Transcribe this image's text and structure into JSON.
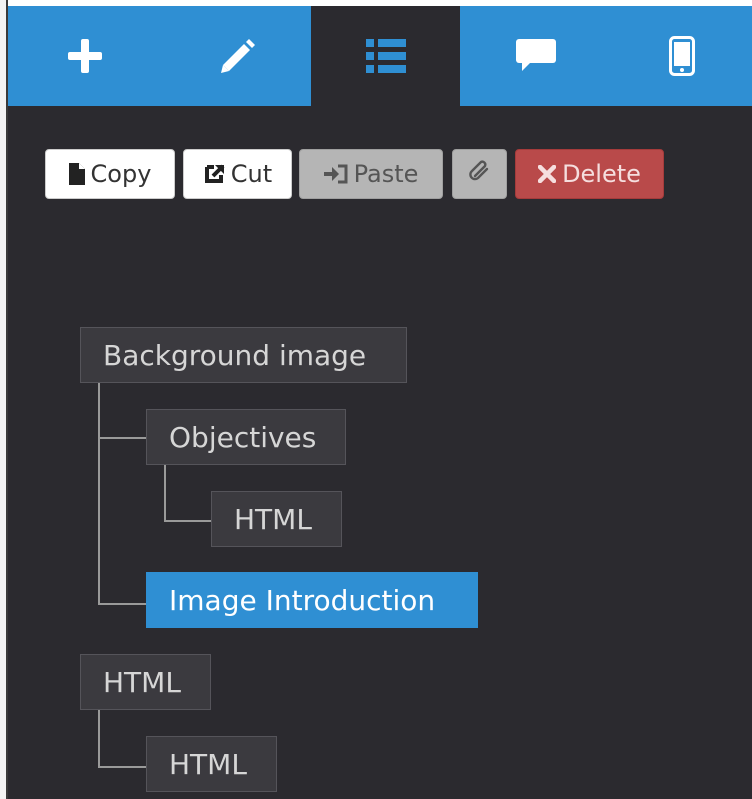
{
  "tabs": [
    {
      "name": "add",
      "icon": "plus-icon",
      "active": false
    },
    {
      "name": "edit",
      "icon": "pencil-icon",
      "active": false
    },
    {
      "name": "structure",
      "icon": "list-icon",
      "active": true
    },
    {
      "name": "comments",
      "icon": "comment-icon",
      "active": false
    },
    {
      "name": "mobile",
      "icon": "mobile-icon",
      "active": false
    }
  ],
  "toolbar": {
    "copy_label": "Copy",
    "cut_label": "Cut",
    "paste_label": "Paste",
    "delete_label": "Delete"
  },
  "tree": {
    "nodes": [
      {
        "label": "Background image"
      },
      {
        "label": "Objectives"
      },
      {
        "label": "HTML"
      },
      {
        "label": "Image Introduction",
        "selected": true
      },
      {
        "label": "HTML"
      },
      {
        "label": "HTML"
      }
    ]
  },
  "colors": {
    "tab_blue": "#2f8fd3",
    "panel_bg": "#2b2a2f",
    "delete_red": "#b94a4a"
  }
}
